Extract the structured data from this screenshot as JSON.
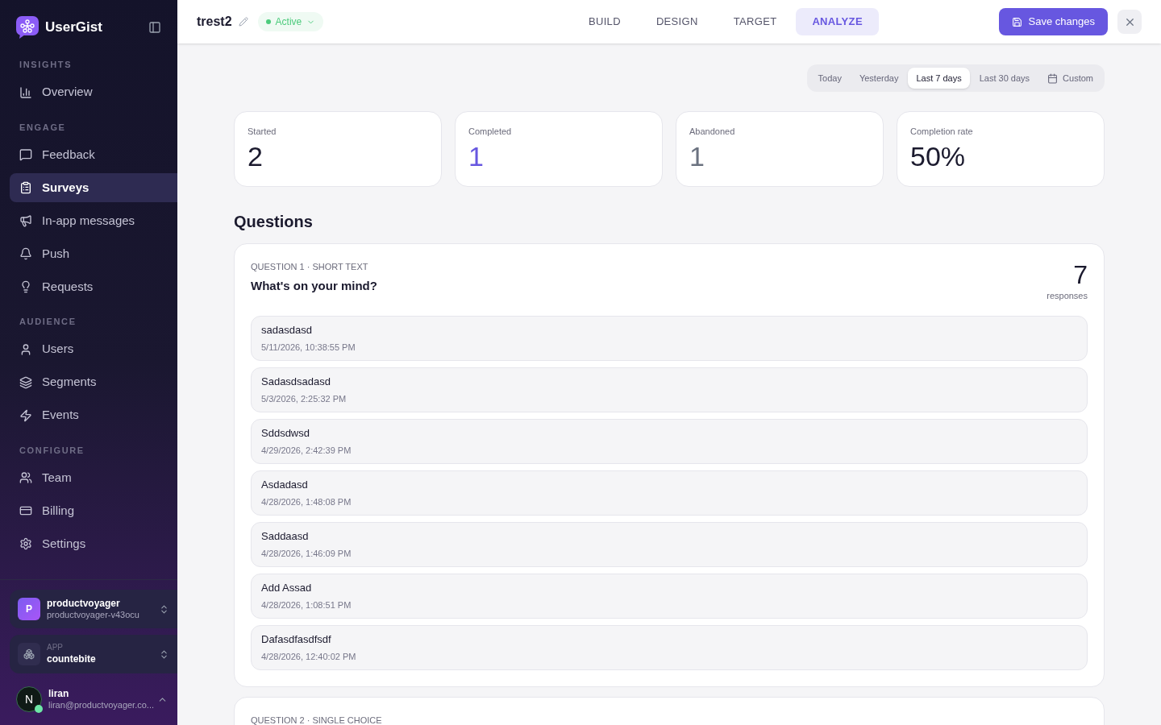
{
  "sidebar": {
    "brand": "UserGist",
    "sections": [
      {
        "title": "INSIGHTS",
        "items": [
          {
            "label": "Overview",
            "selected": false
          }
        ]
      },
      {
        "title": "ENGAGE",
        "items": [
          {
            "label": "Feedback",
            "selected": false
          },
          {
            "label": "Surveys",
            "selected": true
          },
          {
            "label": "In-app messages",
            "selected": false
          },
          {
            "label": "Push",
            "selected": false
          },
          {
            "label": "Requests",
            "selected": false
          }
        ]
      },
      {
        "title": "AUDIENCE",
        "items": [
          {
            "label": "Users",
            "selected": false
          },
          {
            "label": "Segments",
            "selected": false
          },
          {
            "label": "Events",
            "selected": false
          }
        ]
      },
      {
        "title": "CONFIGURE",
        "items": [
          {
            "label": "Team",
            "selected": false
          },
          {
            "label": "Billing",
            "selected": false
          },
          {
            "label": "Settings",
            "selected": false
          }
        ]
      }
    ],
    "workspace": {
      "initial": "P",
      "name": "productvoyager",
      "slug": "productvoyager-v43ocu"
    },
    "app": {
      "label": "APP",
      "name": "countebite"
    },
    "user": {
      "initial": "N",
      "name": "liran",
      "email": "liran@productvoyager.co..."
    }
  },
  "header": {
    "title": "trest2",
    "status": "Active",
    "tabs": [
      {
        "label": "BUILD",
        "selected": false
      },
      {
        "label": "DESIGN",
        "selected": false
      },
      {
        "label": "TARGET",
        "selected": false
      },
      {
        "label": "ANALYZE",
        "selected": true
      }
    ],
    "save": "Save changes"
  },
  "ranges": [
    {
      "label": "Today",
      "selected": false
    },
    {
      "label": "Yesterday",
      "selected": false
    },
    {
      "label": "Last 7 days",
      "selected": true
    },
    {
      "label": "Last 30 days",
      "selected": false
    },
    {
      "label": "Custom",
      "selected": false,
      "kind": "calendar"
    }
  ],
  "stats": [
    {
      "label": "Started",
      "value": "2",
      "color": "#1b1a2e"
    },
    {
      "label": "Completed",
      "value": "1",
      "color": "#6757e0"
    },
    {
      "label": "Abandoned",
      "value": "1",
      "color": "#6b7280"
    },
    {
      "label": "Completion rate",
      "value": "50%",
      "color": "#1b1a2e"
    }
  ],
  "questions_title": "Questions",
  "questions": [
    {
      "meta": "QUESTION 1 · SHORT TEXT",
      "text": "What's on your mind?",
      "count": "7",
      "count_label": "responses",
      "responses": [
        {
          "text": "sadasdasd",
          "time": "5/11/2026, 10:38:55 PM"
        },
        {
          "text": "Sadasdsadasd",
          "time": "5/3/2026, 2:25:32 PM"
        },
        {
          "text": "Sddsdwsd",
          "time": "4/29/2026, 2:42:39 PM"
        },
        {
          "text": "Asdadasd",
          "time": "4/28/2026, 1:48:08 PM"
        },
        {
          "text": "Saddaasd",
          "time": "4/28/2026, 1:46:09 PM"
        },
        {
          "text": "Add Assad",
          "time": "4/28/2026, 1:08:51 PM"
        },
        {
          "text": "Dafasdfasdfsdf",
          "time": "4/28/2026, 12:40:02 PM"
        }
      ]
    },
    {
      "meta": "QUESTION 2 · SINGLE CHOICE"
    }
  ]
}
